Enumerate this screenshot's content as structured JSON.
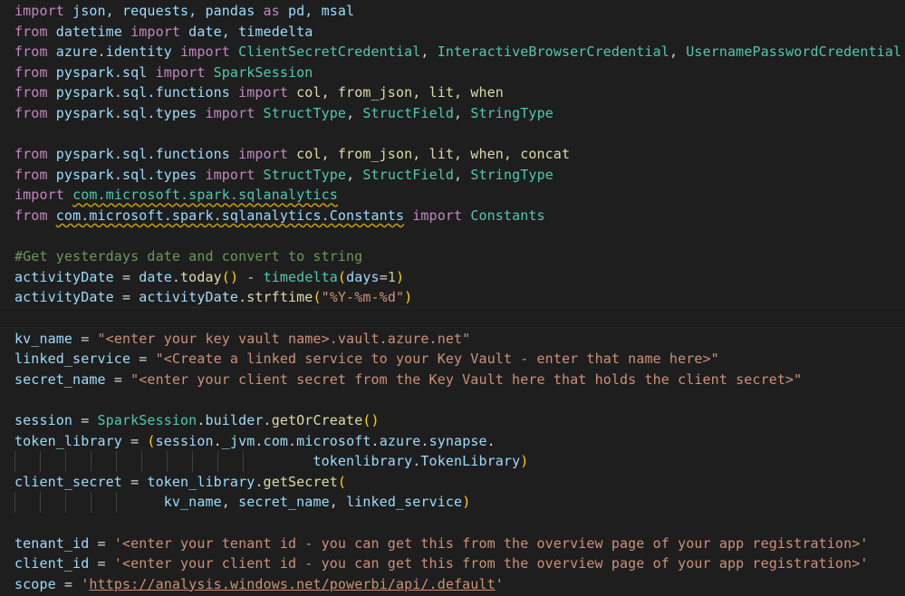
{
  "lines": [
    {
      "segs": [
        [
          "import",
          "kw"
        ],
        [
          " json, requests, pandas ",
          "va"
        ],
        [
          "as",
          "kw"
        ],
        [
          " pd, msal",
          "va"
        ]
      ]
    },
    {
      "segs": [
        [
          "from",
          "kw"
        ],
        [
          " datetime ",
          "va"
        ],
        [
          "import",
          "kw"
        ],
        [
          " date, timedelta",
          "va"
        ]
      ]
    },
    {
      "segs": [
        [
          "from",
          "kw"
        ],
        [
          " azure.identity ",
          "va"
        ],
        [
          "import",
          "kw"
        ],
        [
          " ClientSecretCredential",
          "ty"
        ],
        [
          ", ",
          "pl"
        ],
        [
          "InteractiveBrowserCredential",
          "ty"
        ],
        [
          ", ",
          "pl"
        ],
        [
          "UsernamePasswordCredential",
          "ty"
        ]
      ]
    },
    {
      "segs": [
        [
          "from",
          "kw"
        ],
        [
          " pyspark.sql ",
          "va"
        ],
        [
          "import",
          "kw"
        ],
        [
          " SparkSession",
          "ty"
        ]
      ]
    },
    {
      "segs": [
        [
          "from",
          "kw"
        ],
        [
          " pyspark.sql.functions ",
          "va"
        ],
        [
          "import",
          "kw"
        ],
        [
          " col, from_json, lit, when",
          "fn"
        ]
      ]
    },
    {
      "segs": [
        [
          "from",
          "kw"
        ],
        [
          " pyspark.sql.types ",
          "va"
        ],
        [
          "import",
          "kw"
        ],
        [
          " StructType",
          "ty"
        ],
        [
          ", ",
          "pl"
        ],
        [
          "StructField",
          "ty"
        ],
        [
          ", ",
          "pl"
        ],
        [
          "StringType",
          "ty"
        ]
      ]
    },
    {
      "segs": []
    },
    {
      "segs": [
        [
          "from",
          "kw"
        ],
        [
          " pyspark.sql.functions ",
          "va"
        ],
        [
          "import",
          "kw"
        ],
        [
          " col, from_json, lit, when, concat",
          "fn"
        ]
      ]
    },
    {
      "segs": [
        [
          "from",
          "kw"
        ],
        [
          " pyspark.sql.types ",
          "va"
        ],
        [
          "import",
          "kw"
        ],
        [
          " StructType",
          "ty"
        ],
        [
          ", ",
          "pl"
        ],
        [
          "StructField",
          "ty"
        ],
        [
          ", ",
          "pl"
        ],
        [
          "StringType",
          "ty"
        ]
      ]
    },
    {
      "segs": [
        [
          "import",
          "kw"
        ],
        [
          " ",
          "pl"
        ],
        [
          "com.microsoft.spark.sqlanalytics",
          "ty sq"
        ]
      ]
    },
    {
      "segs": [
        [
          "from",
          "kw"
        ],
        [
          " ",
          "pl"
        ],
        [
          "com.microsoft.spark.sqlanalytics.Constants",
          "va sq"
        ],
        [
          " import",
          "kw"
        ],
        [
          " Constants",
          "ty"
        ]
      ]
    },
    {
      "segs": []
    },
    {
      "segs": [
        [
          "#Get yesterdays date and convert to string",
          "cm"
        ]
      ]
    },
    {
      "segs": [
        [
          "activityDate",
          "va"
        ],
        [
          " = ",
          "pl"
        ],
        [
          "date",
          "va"
        ],
        [
          ".",
          "pl"
        ],
        [
          "today",
          "fn"
        ],
        [
          "()",
          "br1"
        ],
        [
          " - ",
          "pl"
        ],
        [
          "timedelta",
          "ty"
        ],
        [
          "(",
          "br1"
        ],
        [
          "days",
          "va"
        ],
        [
          "=",
          "pl"
        ],
        [
          "1",
          "nu"
        ],
        [
          ")",
          "br1"
        ]
      ]
    },
    {
      "segs": [
        [
          "activityDate",
          "va"
        ],
        [
          " = ",
          "pl"
        ],
        [
          "activityDate",
          "va"
        ],
        [
          ".",
          "pl"
        ],
        [
          "strftime",
          "fn"
        ],
        [
          "(",
          "br1"
        ],
        [
          "\"%Y-%m-%d\"",
          "st"
        ],
        [
          ")",
          "br1"
        ]
      ]
    },
    {
      "segs": []
    },
    {
      "segs": [
        [
          "kv_name",
          "va"
        ],
        [
          " = ",
          "pl"
        ],
        [
          "\"<enter your key vault name>.vault.azure.net\"",
          "st"
        ]
      ]
    },
    {
      "segs": [
        [
          "linked_service",
          "va"
        ],
        [
          " = ",
          "pl"
        ],
        [
          "\"<Create a linked service to your Key Vault - enter that name here>\"",
          "st"
        ]
      ]
    },
    {
      "segs": [
        [
          "secret_name",
          "va"
        ],
        [
          " = ",
          "pl"
        ],
        [
          "\"<enter your client secret from the Key Vault here that holds the client secret>\"",
          "st"
        ]
      ]
    },
    {
      "segs": []
    },
    {
      "segs": [
        [
          "session",
          "va"
        ],
        [
          " = ",
          "pl"
        ],
        [
          "SparkSession",
          "ty"
        ],
        [
          ".",
          "pl"
        ],
        [
          "builder",
          "va"
        ],
        [
          ".",
          "pl"
        ],
        [
          "getOrCreate",
          "fn"
        ],
        [
          "()",
          "br1"
        ]
      ]
    },
    {
      "segs": [
        [
          "token_library",
          "va"
        ],
        [
          " = ",
          "pl"
        ],
        [
          "(",
          "br1"
        ],
        [
          "session",
          "va"
        ],
        [
          ".",
          "pl"
        ],
        [
          "_jvm",
          "va"
        ],
        [
          ".",
          "pl"
        ],
        [
          "com",
          "va"
        ],
        [
          ".",
          "pl"
        ],
        [
          "microsoft",
          "va"
        ],
        [
          ".",
          "pl"
        ],
        [
          "azure",
          "va"
        ],
        [
          ".",
          "pl"
        ],
        [
          "synapse",
          "va"
        ],
        [
          ".",
          "pl"
        ]
      ]
    },
    {
      "segs": [
        [
          "                                    ",
          "pl"
        ],
        [
          "tokenlibrary",
          "va"
        ],
        [
          ".",
          "pl"
        ],
        [
          "TokenLibrary",
          "va"
        ],
        [
          ")",
          "br1"
        ]
      ]
    },
    {
      "segs": [
        [
          "client_secret",
          "va"
        ],
        [
          " = ",
          "pl"
        ],
        [
          "token_library",
          "va"
        ],
        [
          ".",
          "pl"
        ],
        [
          "getSecret",
          "fn"
        ],
        [
          "(",
          "br1"
        ]
      ]
    },
    {
      "segs": [
        [
          "                  ",
          "pl"
        ],
        [
          "kv_name",
          "va"
        ],
        [
          ", ",
          "pl"
        ],
        [
          "secret_name",
          "va"
        ],
        [
          ", ",
          "pl"
        ],
        [
          "linked_service",
          "va"
        ],
        [
          ")",
          "br1"
        ]
      ]
    },
    {
      "segs": []
    },
    {
      "segs": [
        [
          "tenant_id",
          "va"
        ],
        [
          " = ",
          "pl"
        ],
        [
          "'<enter your tenant id - you can get this from the overview page of your app registration>'",
          "st"
        ]
      ]
    },
    {
      "segs": [
        [
          "client_id",
          "va"
        ],
        [
          " = ",
          "pl"
        ],
        [
          "'<enter your client id - you can get this from the overview page of your app registration>'",
          "st"
        ]
      ]
    },
    {
      "segs": [
        [
          "scope",
          "va"
        ],
        [
          " = ",
          "pl"
        ],
        [
          "'",
          "st"
        ],
        [
          "https://analysis.windows.net/powerbi/api/.default",
          "st ul"
        ],
        [
          "'",
          "st"
        ]
      ]
    }
  ]
}
